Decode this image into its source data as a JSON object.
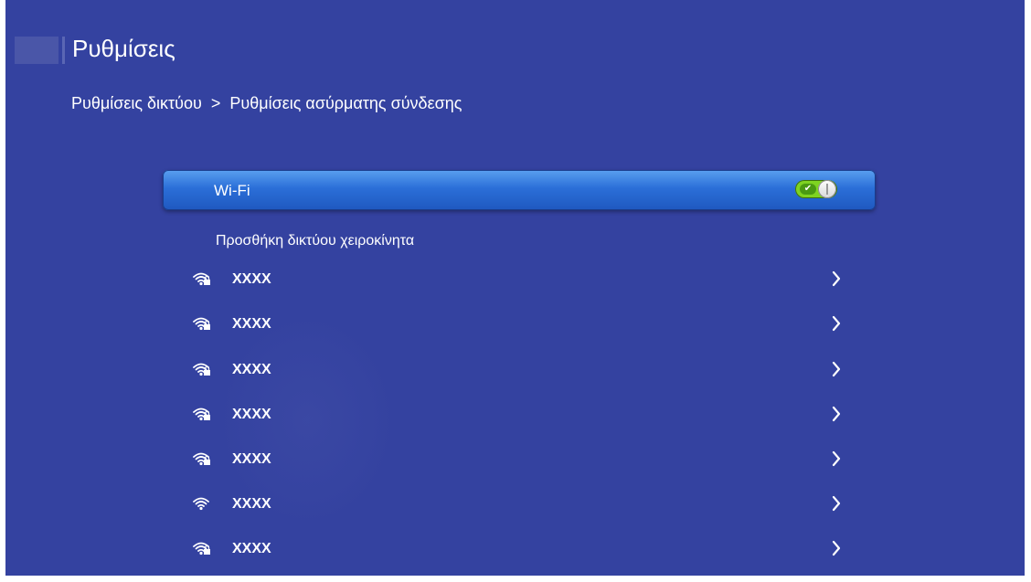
{
  "header": {
    "title": "Ρυθμίσεις"
  },
  "breadcrumb": {
    "items": [
      "Ρυθμίσεις δικτύου",
      "Ρυθμίσεις ασύρματης σύνδεσης"
    ],
    "separator": ">"
  },
  "wifi": {
    "label": "Wi-Fi",
    "enabled": true,
    "check_glyph": "✔"
  },
  "add_manual": {
    "label": "Προσθήκη δικτύου χειροκίνητα"
  },
  "networks": [
    {
      "name": "XXXX",
      "icon": "wifi-locked-icon",
      "chevron": "chevron-right-icon"
    },
    {
      "name": "XXXX",
      "icon": "wifi-locked-icon",
      "chevron": "chevron-right-icon"
    },
    {
      "name": "XXXX",
      "icon": "wifi-locked-icon",
      "chevron": "chevron-right-icon"
    },
    {
      "name": "XXXX",
      "icon": "wifi-locked-icon",
      "chevron": "chevron-right-icon"
    },
    {
      "name": "XXXX",
      "icon": "wifi-locked-icon",
      "chevron": "chevron-right-icon"
    },
    {
      "name": "XXXX",
      "icon": "wifi-open-icon",
      "chevron": "chevron-right-icon"
    },
    {
      "name": "XXXX",
      "icon": "wifi-locked-icon",
      "chevron": "chevron-right-icon"
    }
  ],
  "colors": {
    "background": "#3442a0",
    "highlight": "#2b6fd8",
    "toggle_on": "#7fd321",
    "text": "#ffffff"
  }
}
